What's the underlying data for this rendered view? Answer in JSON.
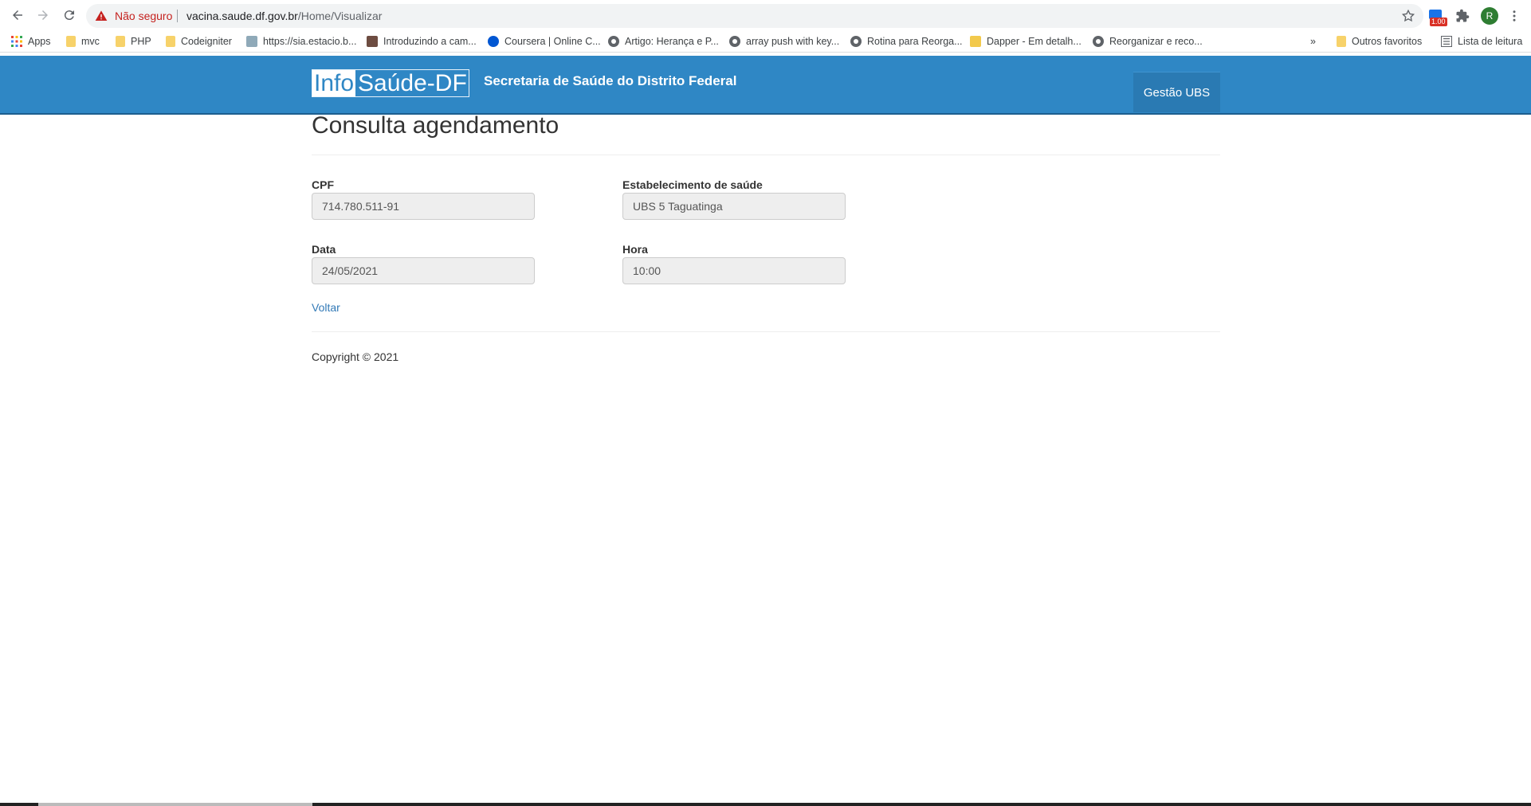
{
  "browser": {
    "security_label": "Não seguro",
    "url_host": "vacina.saude.df.gov.br",
    "url_path": "/Home/Visualizar",
    "ext_badge": "1.00",
    "avatar_letter": "R",
    "bookmarks": [
      {
        "label": "Apps",
        "icon": "apps-grid-icon"
      },
      {
        "label": "mvc",
        "icon": "folder-icon"
      },
      {
        "label": "PHP",
        "icon": "folder-icon"
      },
      {
        "label": "Codeigniter",
        "icon": "folder-icon"
      },
      {
        "label": "https://sia.estacio.b...",
        "icon": "site-icon"
      },
      {
        "label": "Introduzindo a cam...",
        "icon": "site-icon"
      },
      {
        "label": "Coursera | Online C...",
        "icon": "coursera-icon"
      },
      {
        "label": "Artigo: Herança e P...",
        "icon": "globe-icon"
      },
      {
        "label": "array push with key...",
        "icon": "globe-icon"
      },
      {
        "label": "Rotina para Reorga...",
        "icon": "globe-icon"
      },
      {
        "label": "Dapper - Em detalh...",
        "icon": "site-icon"
      },
      {
        "label": "Reorganizar e reco...",
        "icon": "globe-icon"
      }
    ],
    "overflow_label": "»",
    "other_favorites": "Outros favoritos",
    "reading_list": "Lista de leitura"
  },
  "navbar": {
    "logo_info": "Info",
    "logo_saude": "Saúde-DF",
    "title": "Secretaria de Saúde do Distrito Federal",
    "link": "Gestão UBS"
  },
  "page": {
    "title": "Consulta agendamento",
    "fields": {
      "cpf": {
        "label": "CPF",
        "value": "714.780.511-91"
      },
      "estabelecimento": {
        "label": "Estabelecimento de saúde",
        "value": "UBS 5 Taguatinga"
      },
      "data": {
        "label": "Data",
        "value": "24/05/2021"
      },
      "hora": {
        "label": "Hora",
        "value": "10:00"
      }
    },
    "back_link": "Voltar",
    "copyright": "Copyright © 2021"
  },
  "colors": {
    "navbar": "#2f87c5",
    "link": "#337ab7",
    "input_bg": "#eeeeee"
  }
}
